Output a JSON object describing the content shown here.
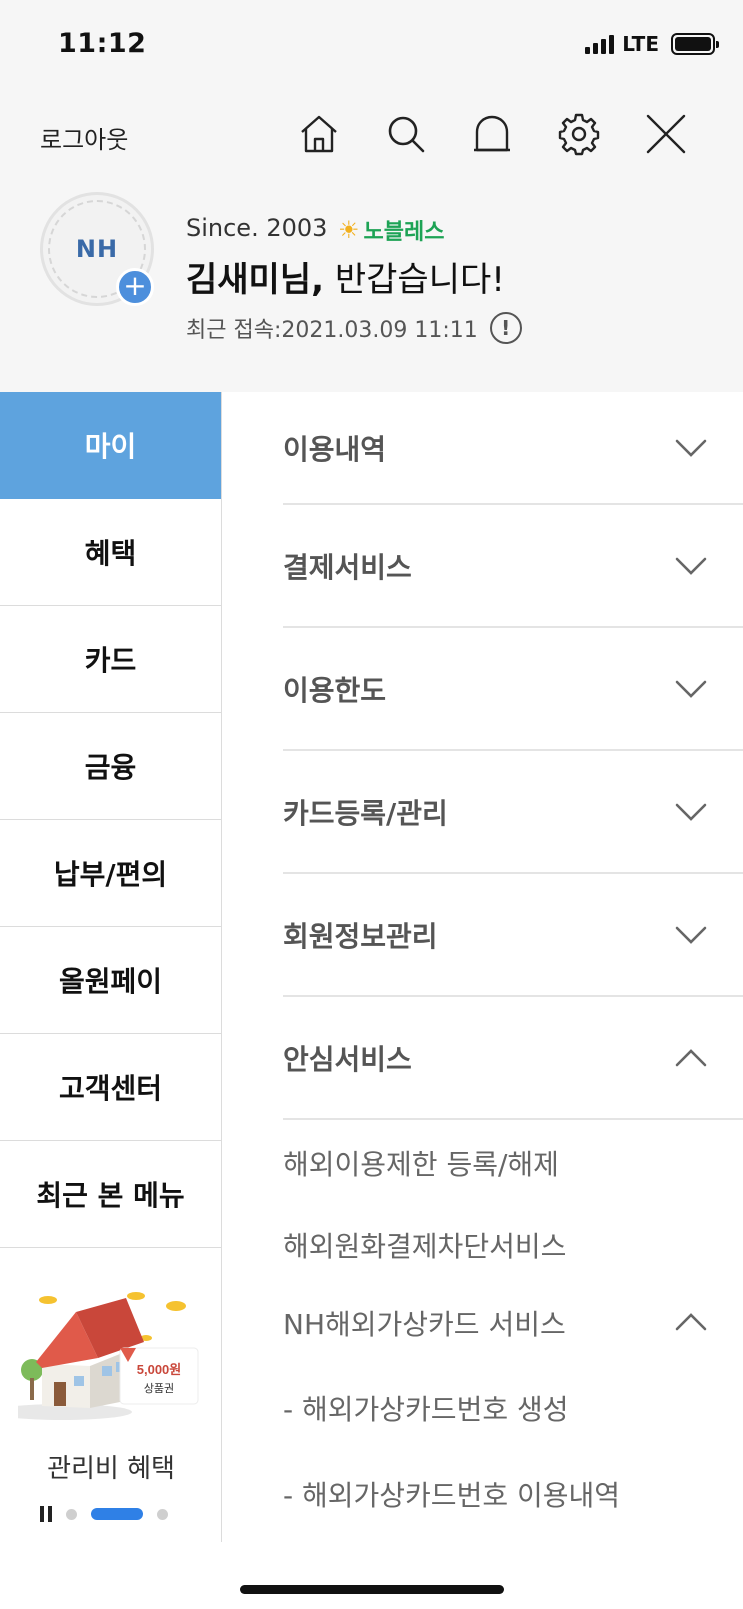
{
  "status_bar": {
    "time": "11:12",
    "network": "LTE"
  },
  "header": {
    "logout_label": "로그아웃",
    "icons": [
      "home-icon",
      "search-icon",
      "bell-icon",
      "gear-icon",
      "close-icon"
    ]
  },
  "profile": {
    "avatar_text": "NH",
    "avatar_add": "+",
    "since": "Since. 2003",
    "grade_icon": "☀",
    "grade": "노블레스",
    "greeting_name": "김새미님,",
    "greeting_text": " 반갑습니다!",
    "last_login": "최근 접속:2021.03.09 11:11",
    "info_icon": "!"
  },
  "sidebar": {
    "items": [
      {
        "label": "마이",
        "active": true
      },
      {
        "label": "혜택"
      },
      {
        "label": "카드"
      },
      {
        "label": "금융"
      },
      {
        "label": "납부/편의"
      },
      {
        "label": "올원페이"
      },
      {
        "label": "고객센터"
      },
      {
        "label": "최근 본 메뉴"
      }
    ],
    "banner": {
      "voucher_amount": "5,000원",
      "voucher_label": "상품권",
      "caption": "관리비 혜택"
    }
  },
  "menu": {
    "sections": [
      {
        "label": "이용내역",
        "expanded": false
      },
      {
        "label": "결제서비스",
        "expanded": false
      },
      {
        "label": "이용한도",
        "expanded": false
      },
      {
        "label": "카드등록/관리",
        "expanded": false
      },
      {
        "label": "회원정보관리",
        "expanded": false
      },
      {
        "label": "안심서비스",
        "expanded": true
      }
    ],
    "sub_items": [
      {
        "label": "해외이용제한 등록/해제"
      },
      {
        "label": "해외원화결제차단서비스"
      },
      {
        "label": "NH해외가상카드 서비스",
        "expanded": true
      },
      {
        "label": "- 해외가상카드번호 생성"
      },
      {
        "label": "- 해외가상카드번호 이용내역"
      }
    ]
  },
  "colors": {
    "active_tab": "#5ea3de",
    "grade_green": "#1da355",
    "avatar_plus": "#4d8fdc",
    "pager_active": "#2f80e6"
  }
}
